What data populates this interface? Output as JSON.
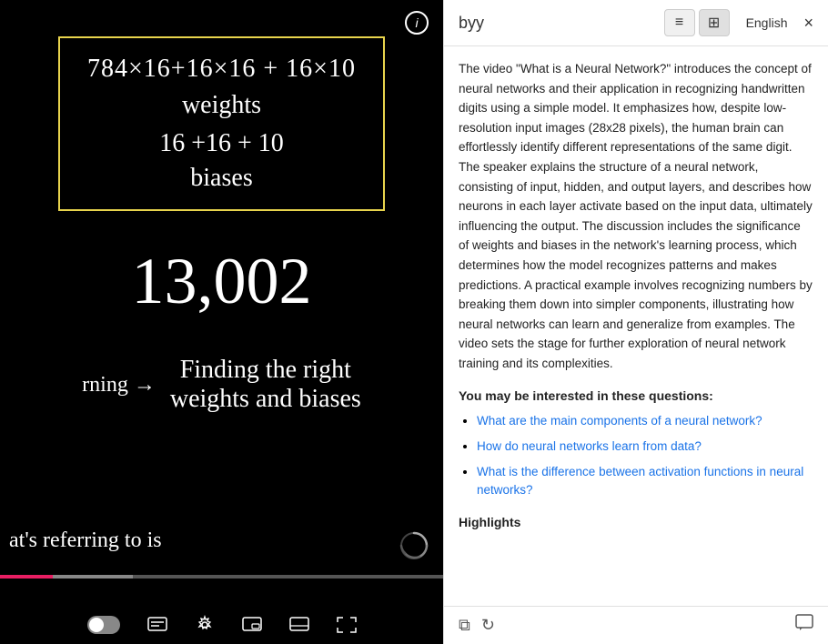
{
  "video": {
    "math_line1": "784×16+16×16 + 16×10",
    "math_label_weights": "weights",
    "biases_line": "16 +16 + 10",
    "biases_label": "biases",
    "total": "13,002",
    "rning": "rning →",
    "finding_line1": "Finding the right",
    "finding_line2": "weights and biases",
    "bottom_text": "at's referring to is",
    "info_icon": "i"
  },
  "sidebar": {
    "byy_label": "byy",
    "hamburger_icon": "≡",
    "grid_icon": "⊞",
    "language": "English",
    "close_icon": "×",
    "summary": "The video \"What is a Neural Network?\" introduces the concept of neural networks and their application in recognizing handwritten digits using a simple model. It emphasizes how, despite low-resolution input images (28x28 pixels), the human brain can effortlessly identify different representations of the same digit. The speaker explains the structure of a neural network, consisting of input, hidden, and output layers, and describes how neurons in each layer activate based on the input data, ultimately influencing the output. The discussion includes the significance of weights and biases in the network's learning process, which determines how the model recognizes patterns and makes predictions. A practical example involves recognizing numbers by breaking them down into simpler components, illustrating how neural networks can learn and generalize from examples. The video sets the stage for further exploration of neural network training and its complexities.",
    "questions_heading": "You may be interested in these questions:",
    "questions": [
      "What are the main components of a neural network?",
      "How do neural networks learn from data?",
      "What is the difference between activation functions in neural networks?"
    ],
    "highlights_heading": "Highlights",
    "footer_copy_icon": "⧉",
    "footer_refresh_icon": "↻",
    "footer_comment_icon": "🗨"
  }
}
